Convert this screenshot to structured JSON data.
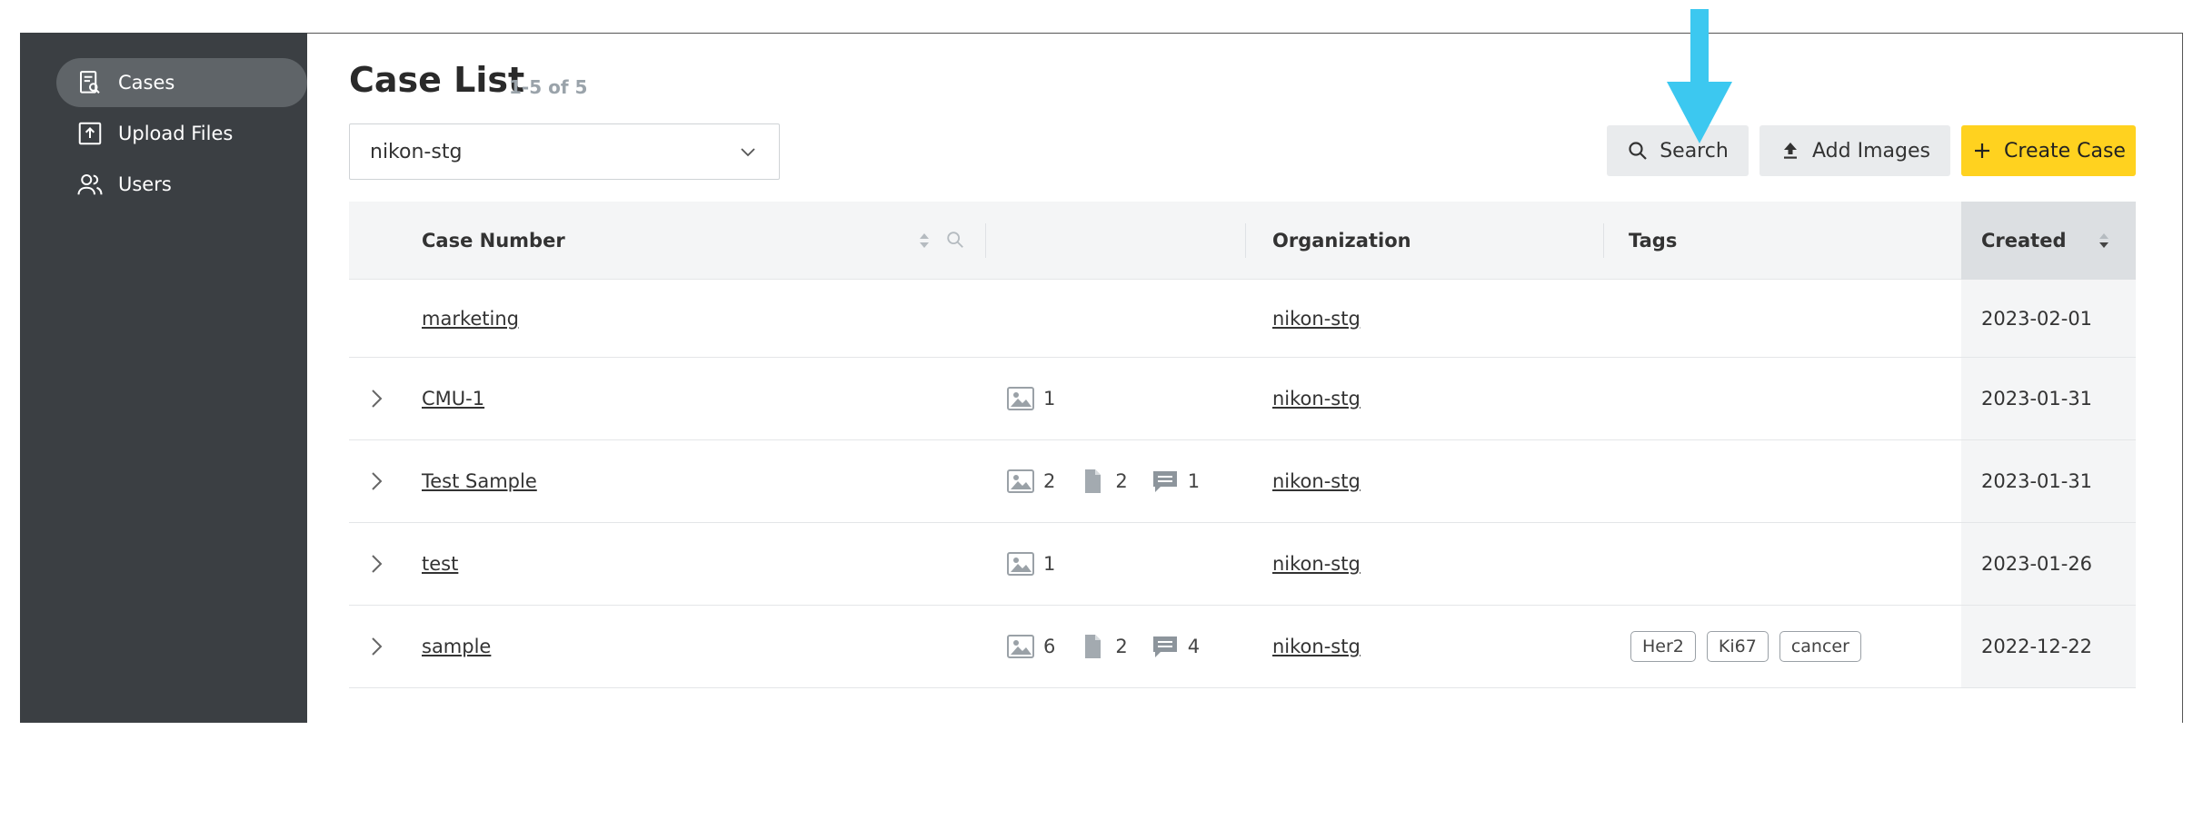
{
  "sidebar": {
    "items": [
      {
        "label": "Cases",
        "icon": "case-search-icon",
        "active": true
      },
      {
        "label": "Upload Files",
        "icon": "upload-icon",
        "active": false
      },
      {
        "label": "Users",
        "icon": "users-icon",
        "active": false
      }
    ]
  },
  "header": {
    "title": "Case List",
    "count": "1-5 of 5"
  },
  "org_select": {
    "value": "nikon-stg"
  },
  "toolbar": {
    "search_label": "Search",
    "add_images_label": "Add Images",
    "create_case_label": "Create Case"
  },
  "table": {
    "columns": {
      "case_number": "Case Number",
      "organization": "Organization",
      "tags": "Tags",
      "created": "Created"
    },
    "rows": [
      {
        "case": "marketing",
        "expandable": false,
        "images": null,
        "files": null,
        "comments": null,
        "org": "nikon-stg",
        "tags": [],
        "created": "2023-02-01"
      },
      {
        "case": "CMU-1",
        "expandable": true,
        "images": "1",
        "files": null,
        "comments": null,
        "org": "nikon-stg",
        "tags": [],
        "created": "2023-01-31"
      },
      {
        "case": "Test Sample",
        "expandable": true,
        "images": "2",
        "files": "2",
        "comments": "1",
        "org": "nikon-stg",
        "tags": [],
        "created": "2023-01-31"
      },
      {
        "case": "test",
        "expandable": true,
        "images": "1",
        "files": null,
        "comments": null,
        "org": "nikon-stg",
        "tags": [],
        "created": "2023-01-26"
      },
      {
        "case": "sample",
        "expandable": true,
        "images": "6",
        "files": "2",
        "comments": "4",
        "org": "nikon-stg",
        "tags": [
          "Her2",
          "Ki67",
          "cancer"
        ],
        "created": "2022-12-22"
      }
    ]
  },
  "colors": {
    "sidebar_bg": "#3b3f43",
    "accent_yellow": "#ffd21f",
    "annotation_arrow": "#3cc8f0"
  }
}
